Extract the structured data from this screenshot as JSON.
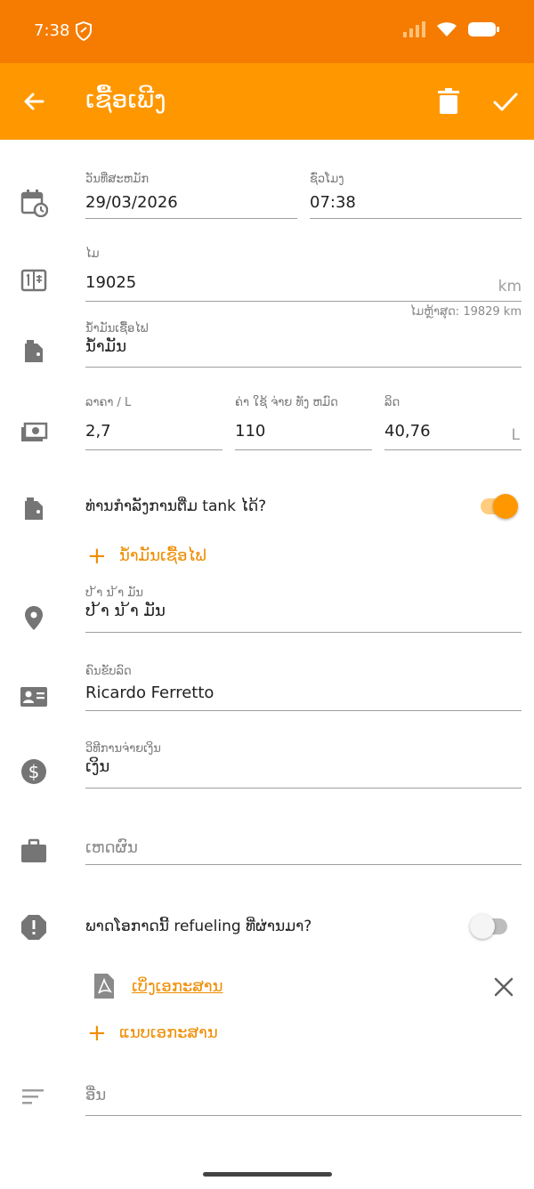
{
  "status": {
    "time": "7:38"
  },
  "appbar": {
    "title": "ເຊື້ອເພີງ"
  },
  "date_field": {
    "label": "ວັນທີ່ສະຫມັກ",
    "value": "29/03/2026"
  },
  "time_field": {
    "label": "ຊົ່ວໂມງ",
    "value": "07:38"
  },
  "odometer": {
    "label": "ໄມ",
    "value": "19025",
    "unit": "km",
    "hint": "ໄມຫຼ້າສຸດ: 19829 km"
  },
  "fuel_type": {
    "label": "ນ້ຳມັນເຊື້ອໄຟ",
    "value": "ນ້ຳມັນ"
  },
  "price": {
    "label": "ລາຄາ / L",
    "value": "2,7"
  },
  "total_cost": {
    "label": "ຄ່າ ໃຊ້ ຈ່າຍ ທັງ ຫມົດ",
    "value": "110"
  },
  "liters": {
    "label": "ລິດ",
    "value": "40,76",
    "unit": "L"
  },
  "full_tank": {
    "label": "ທ່ານກໍາລັງການຕື່ມ tank ໄດ້?",
    "on": true
  },
  "add_fuel": {
    "label": "ນ້ຳມັນເຊື້ອໄຟ"
  },
  "station": {
    "label": "ປ ້າ ນ ້າ ມັນ",
    "value": "ປ ້າ ນ ້າ ມັນ"
  },
  "driver": {
    "label": "ຄົນຂັບລົດ",
    "value": "Ricardo Ferretto"
  },
  "payment": {
    "label": "ວິທີການຈ່າຍເງິນ",
    "value": "ເງິນ"
  },
  "reason": {
    "placeholder": "ເຫດຜົນ"
  },
  "missed": {
    "label": "ພາດໂອກາດນີ້ refueling ທີ່ຜ່ານມາ?",
    "on": false
  },
  "attachment": {
    "label": "ເບິ່ງເອກະສານ"
  },
  "attach": {
    "label": "ແນບເອກະສານ"
  },
  "notes": {
    "placeholder": "ອື່ນ"
  },
  "colors": {
    "primary": "#ff9800",
    "status": "#f57c00",
    "accent": "#ef8c00",
    "icon": "#757575"
  }
}
